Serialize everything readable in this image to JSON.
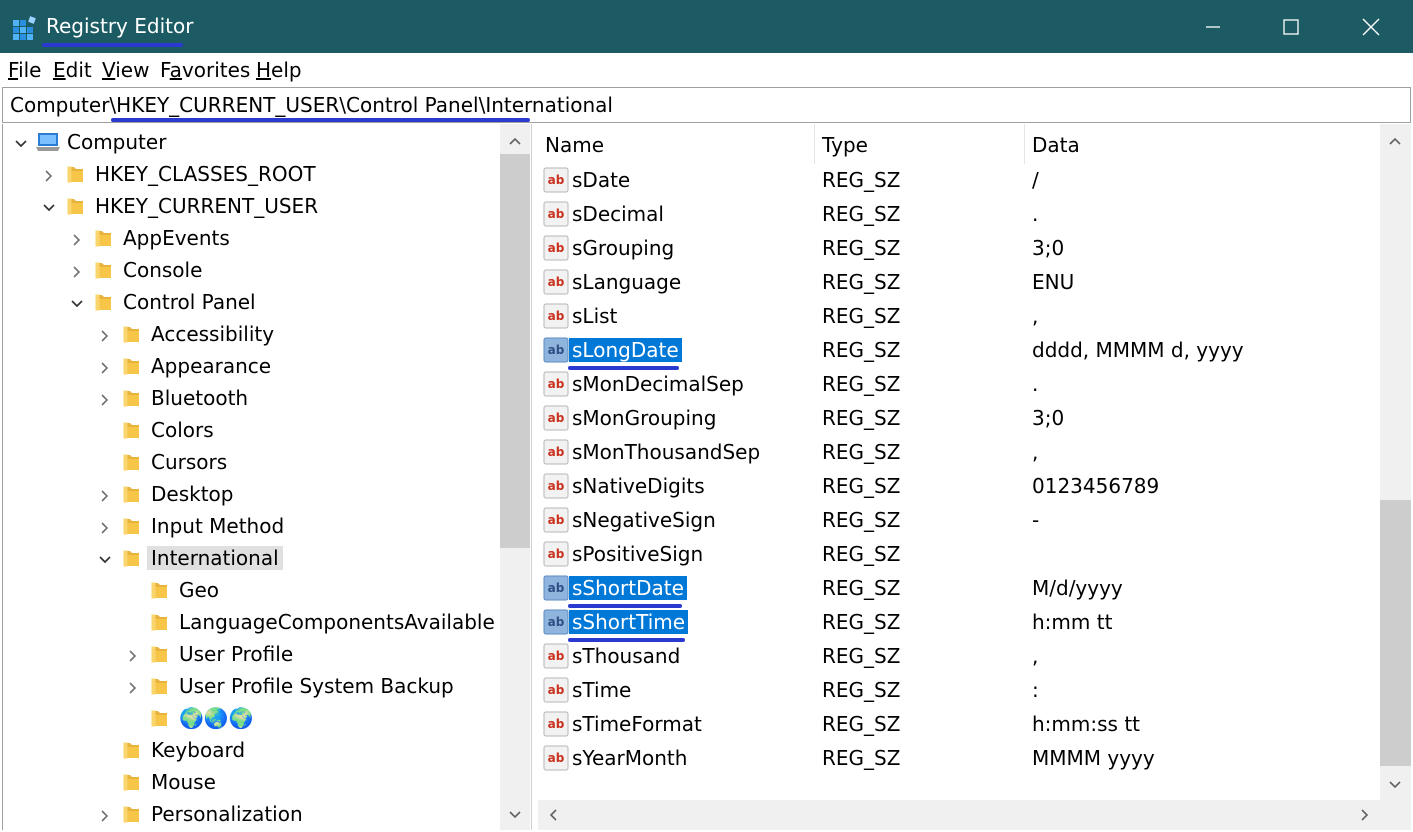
{
  "window": {
    "title": "Registry Editor",
    "icon": "registry-editor-icon",
    "controls": {
      "minimize": "minimize-icon",
      "maximize": "maximize-icon",
      "close": "close-icon"
    },
    "title_bar_color": "#1c5b63"
  },
  "menu": {
    "items": [
      {
        "accel": "F",
        "rest": "ile"
      },
      {
        "accel": "E",
        "rest": "dit"
      },
      {
        "accel": "V",
        "rest": "iew"
      },
      {
        "pre": "F",
        "accel": "a",
        "rest": "vorites"
      },
      {
        "accel": "H",
        "rest": "elp"
      }
    ]
  },
  "address": {
    "path": "Computer\\HKEY_CURRENT_USER\\Control Panel\\International"
  },
  "tree": {
    "items": [
      {
        "label": "Computer",
        "icon": "computer-icon",
        "expanded": true
      },
      {
        "label": "HKEY_CLASSES_ROOT",
        "icon": "folder-icon",
        "expanded": false
      },
      {
        "label": "HKEY_CURRENT_USER",
        "icon": "folder-icon",
        "expanded": true
      },
      {
        "label": "AppEvents",
        "icon": "folder-icon",
        "expanded": false
      },
      {
        "label": "Console",
        "icon": "folder-icon",
        "expanded": false
      },
      {
        "label": "Control Panel",
        "icon": "folder-icon",
        "expanded": true
      },
      {
        "label": "Accessibility",
        "icon": "folder-icon",
        "expanded": false
      },
      {
        "label": "Appearance",
        "icon": "folder-icon",
        "expanded": false
      },
      {
        "label": "Bluetooth",
        "icon": "folder-icon",
        "expanded": false
      },
      {
        "label": "Colors",
        "icon": "folder-icon"
      },
      {
        "label": "Cursors",
        "icon": "folder-icon"
      },
      {
        "label": "Desktop",
        "icon": "folder-icon",
        "expanded": false
      },
      {
        "label": "Input Method",
        "icon": "folder-icon",
        "expanded": false
      },
      {
        "label": "International",
        "icon": "folder-icon",
        "expanded": true,
        "selected": true
      },
      {
        "label": "Geo",
        "icon": "folder-icon"
      },
      {
        "label": "LanguageComponentsAvailable",
        "icon": "folder-icon"
      },
      {
        "label": "User Profile",
        "icon": "folder-icon",
        "expanded": false
      },
      {
        "label": "User Profile System Backup",
        "icon": "folder-icon",
        "expanded": false
      },
      {
        "label": "🌍🌏🌍",
        "icon": "folder-icon"
      },
      {
        "label": "Keyboard",
        "icon": "folder-icon"
      },
      {
        "label": "Mouse",
        "icon": "folder-icon"
      },
      {
        "label": "Personalization",
        "icon": "folder-icon",
        "expanded": false
      }
    ]
  },
  "list": {
    "columns": [
      "Name",
      "Type",
      "Data"
    ],
    "rows": [
      {
        "name": "sDate",
        "type": "REG_SZ",
        "data": "/"
      },
      {
        "name": "sDecimal",
        "type": "REG_SZ",
        "data": "."
      },
      {
        "name": "sGrouping",
        "type": "REG_SZ",
        "data": "3;0"
      },
      {
        "name": "sLanguage",
        "type": "REG_SZ",
        "data": "ENU"
      },
      {
        "name": "sList",
        "type": "REG_SZ",
        "data": ","
      },
      {
        "name": "sLongDate",
        "type": "REG_SZ",
        "data": "dddd, MMMM d, yyyy",
        "selected": true
      },
      {
        "name": "sMonDecimalSep",
        "type": "REG_SZ",
        "data": "."
      },
      {
        "name": "sMonGrouping",
        "type": "REG_SZ",
        "data": "3;0"
      },
      {
        "name": "sMonThousandSep",
        "type": "REG_SZ",
        "data": ","
      },
      {
        "name": "sNativeDigits",
        "type": "REG_SZ",
        "data": "0123456789"
      },
      {
        "name": "sNegativeSign",
        "type": "REG_SZ",
        "data": "-"
      },
      {
        "name": "sPositiveSign",
        "type": "REG_SZ",
        "data": ""
      },
      {
        "name": "sShortDate",
        "type": "REG_SZ",
        "data": "M/d/yyyy",
        "selected": true
      },
      {
        "name": "sShortTime",
        "type": "REG_SZ",
        "data": "h:mm tt",
        "selected": true
      },
      {
        "name": "sThousand",
        "type": "REG_SZ",
        "data": ","
      },
      {
        "name": "sTime",
        "type": "REG_SZ",
        "data": ":"
      },
      {
        "name": "sTimeFormat",
        "type": "REG_SZ",
        "data": "h:mm:ss tt"
      },
      {
        "name": "sYearMonth",
        "type": "REG_SZ",
        "data": "MMMM yyyy"
      }
    ]
  },
  "colors": {
    "selection": "#0078d7",
    "annotation_underline": "#2a3ad0",
    "folder": "#f7c548"
  }
}
